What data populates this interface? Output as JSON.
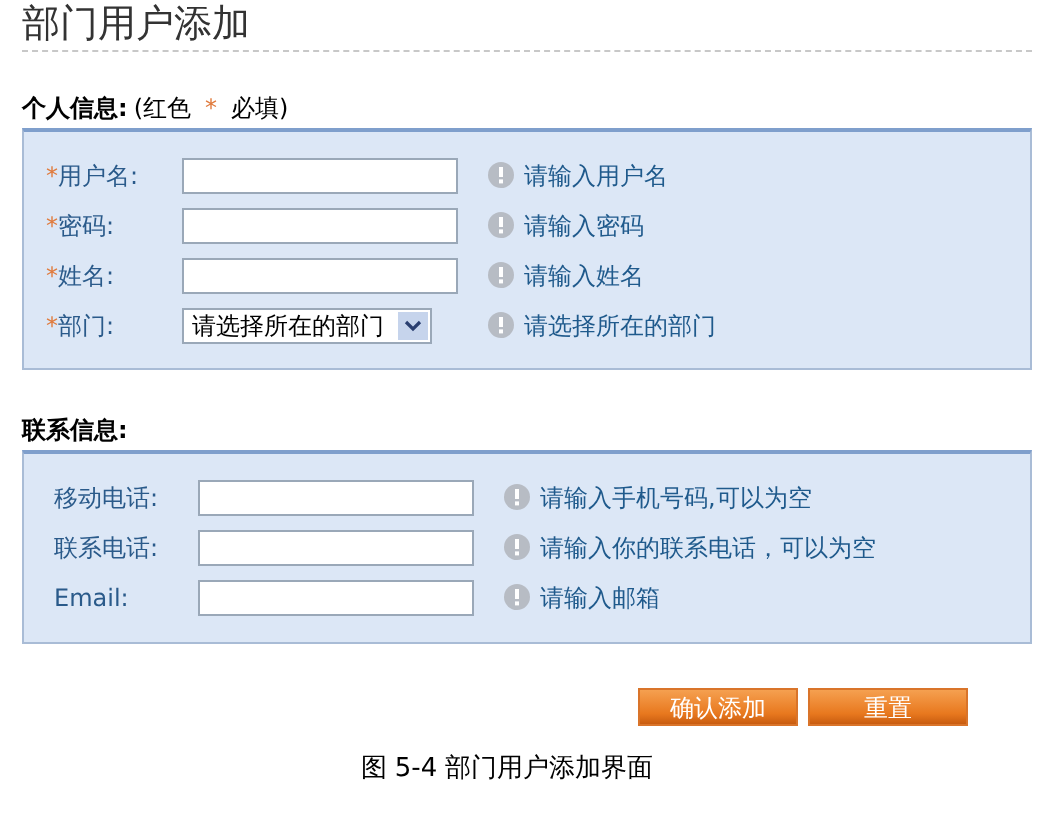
{
  "title": "部门用户添加",
  "sections": [
    {
      "heading": "个人信息:",
      "note": {
        "before": "(红色",
        "mark": "*",
        "after": "必填)"
      },
      "fields": [
        {
          "label": "用户名:",
          "required": true,
          "kind": "text",
          "hint": "请输入用户名"
        },
        {
          "label": "密码:",
          "required": true,
          "kind": "text",
          "hint": "请输入密码"
        },
        {
          "label": "姓名:",
          "required": true,
          "kind": "text",
          "hint": "请输入姓名"
        },
        {
          "label": "部门:",
          "required": true,
          "kind": "select",
          "value": "请选择所在的部门",
          "hint": "请选择所在的部门"
        }
      ]
    },
    {
      "heading": "联系信息:",
      "fields": [
        {
          "label": "移动电话:",
          "required": false,
          "kind": "text",
          "hint": "请输入手机号码,可以为空"
        },
        {
          "label": "联系电话:",
          "required": false,
          "kind": "text",
          "hint": "请输入你的联系电话，可以为空"
        },
        {
          "label": "Email:",
          "required": false,
          "kind": "text",
          "hint": "请输入邮箱"
        }
      ]
    }
  ],
  "buttons": [
    "确认添加",
    "重置"
  ],
  "caption": "图 5-4 部门用户添加界面"
}
